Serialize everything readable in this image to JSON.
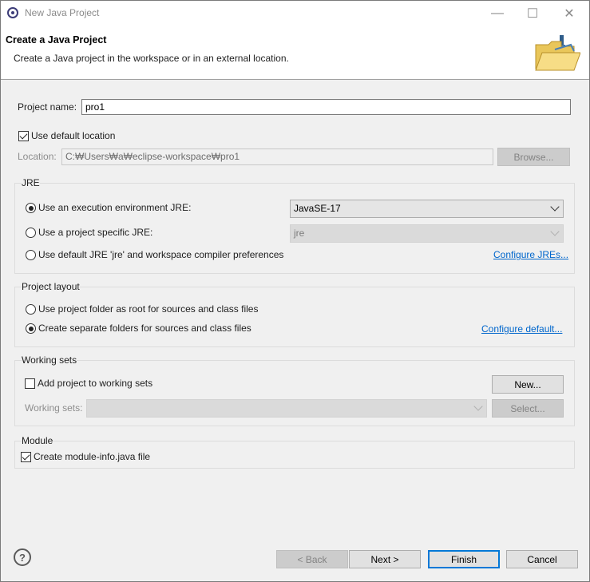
{
  "window": {
    "title": "New Java Project",
    "minimize": "—",
    "maximize": "☐",
    "close": "✕"
  },
  "header": {
    "title": "Create a Java Project",
    "description": "Create a Java project in the workspace or in an external location."
  },
  "project": {
    "name_label": "Project name:",
    "name_value": "pro1",
    "use_default_location_label": "Use default location",
    "use_default_location": true,
    "location_label": "Location:",
    "location_value": "C:₩Users₩a₩eclipse-workspace₩pro1",
    "browse_label": "Browse..."
  },
  "jre": {
    "title": "JRE",
    "option_env_label": "Use an execution environment JRE:",
    "option_env_value": "JavaSE-17",
    "option_specific_label": "Use a project specific JRE:",
    "option_specific_value": "jre",
    "option_default_label": "Use default JRE 'jre' and workspace compiler preferences",
    "configure_link": "Configure JREs...",
    "selected": "env"
  },
  "layout": {
    "title": "Project layout",
    "option_root_label": "Use project folder as root for sources and class files",
    "option_separate_label": "Create separate folders for sources and class files",
    "configure_link": "Configure default...",
    "selected": "separate"
  },
  "working_sets": {
    "title": "Working sets",
    "add_label": "Add project to working sets",
    "add_checked": false,
    "new_label": "New...",
    "sets_label": "Working sets:",
    "sets_value": "",
    "select_label": "Select..."
  },
  "module": {
    "title": "Module",
    "create_label": "Create module-info.java file",
    "create_checked": true
  },
  "footer": {
    "help": "?",
    "back_label": "< Back",
    "next_label": "Next >",
    "finish_label": "Finish",
    "cancel_label": "Cancel"
  }
}
